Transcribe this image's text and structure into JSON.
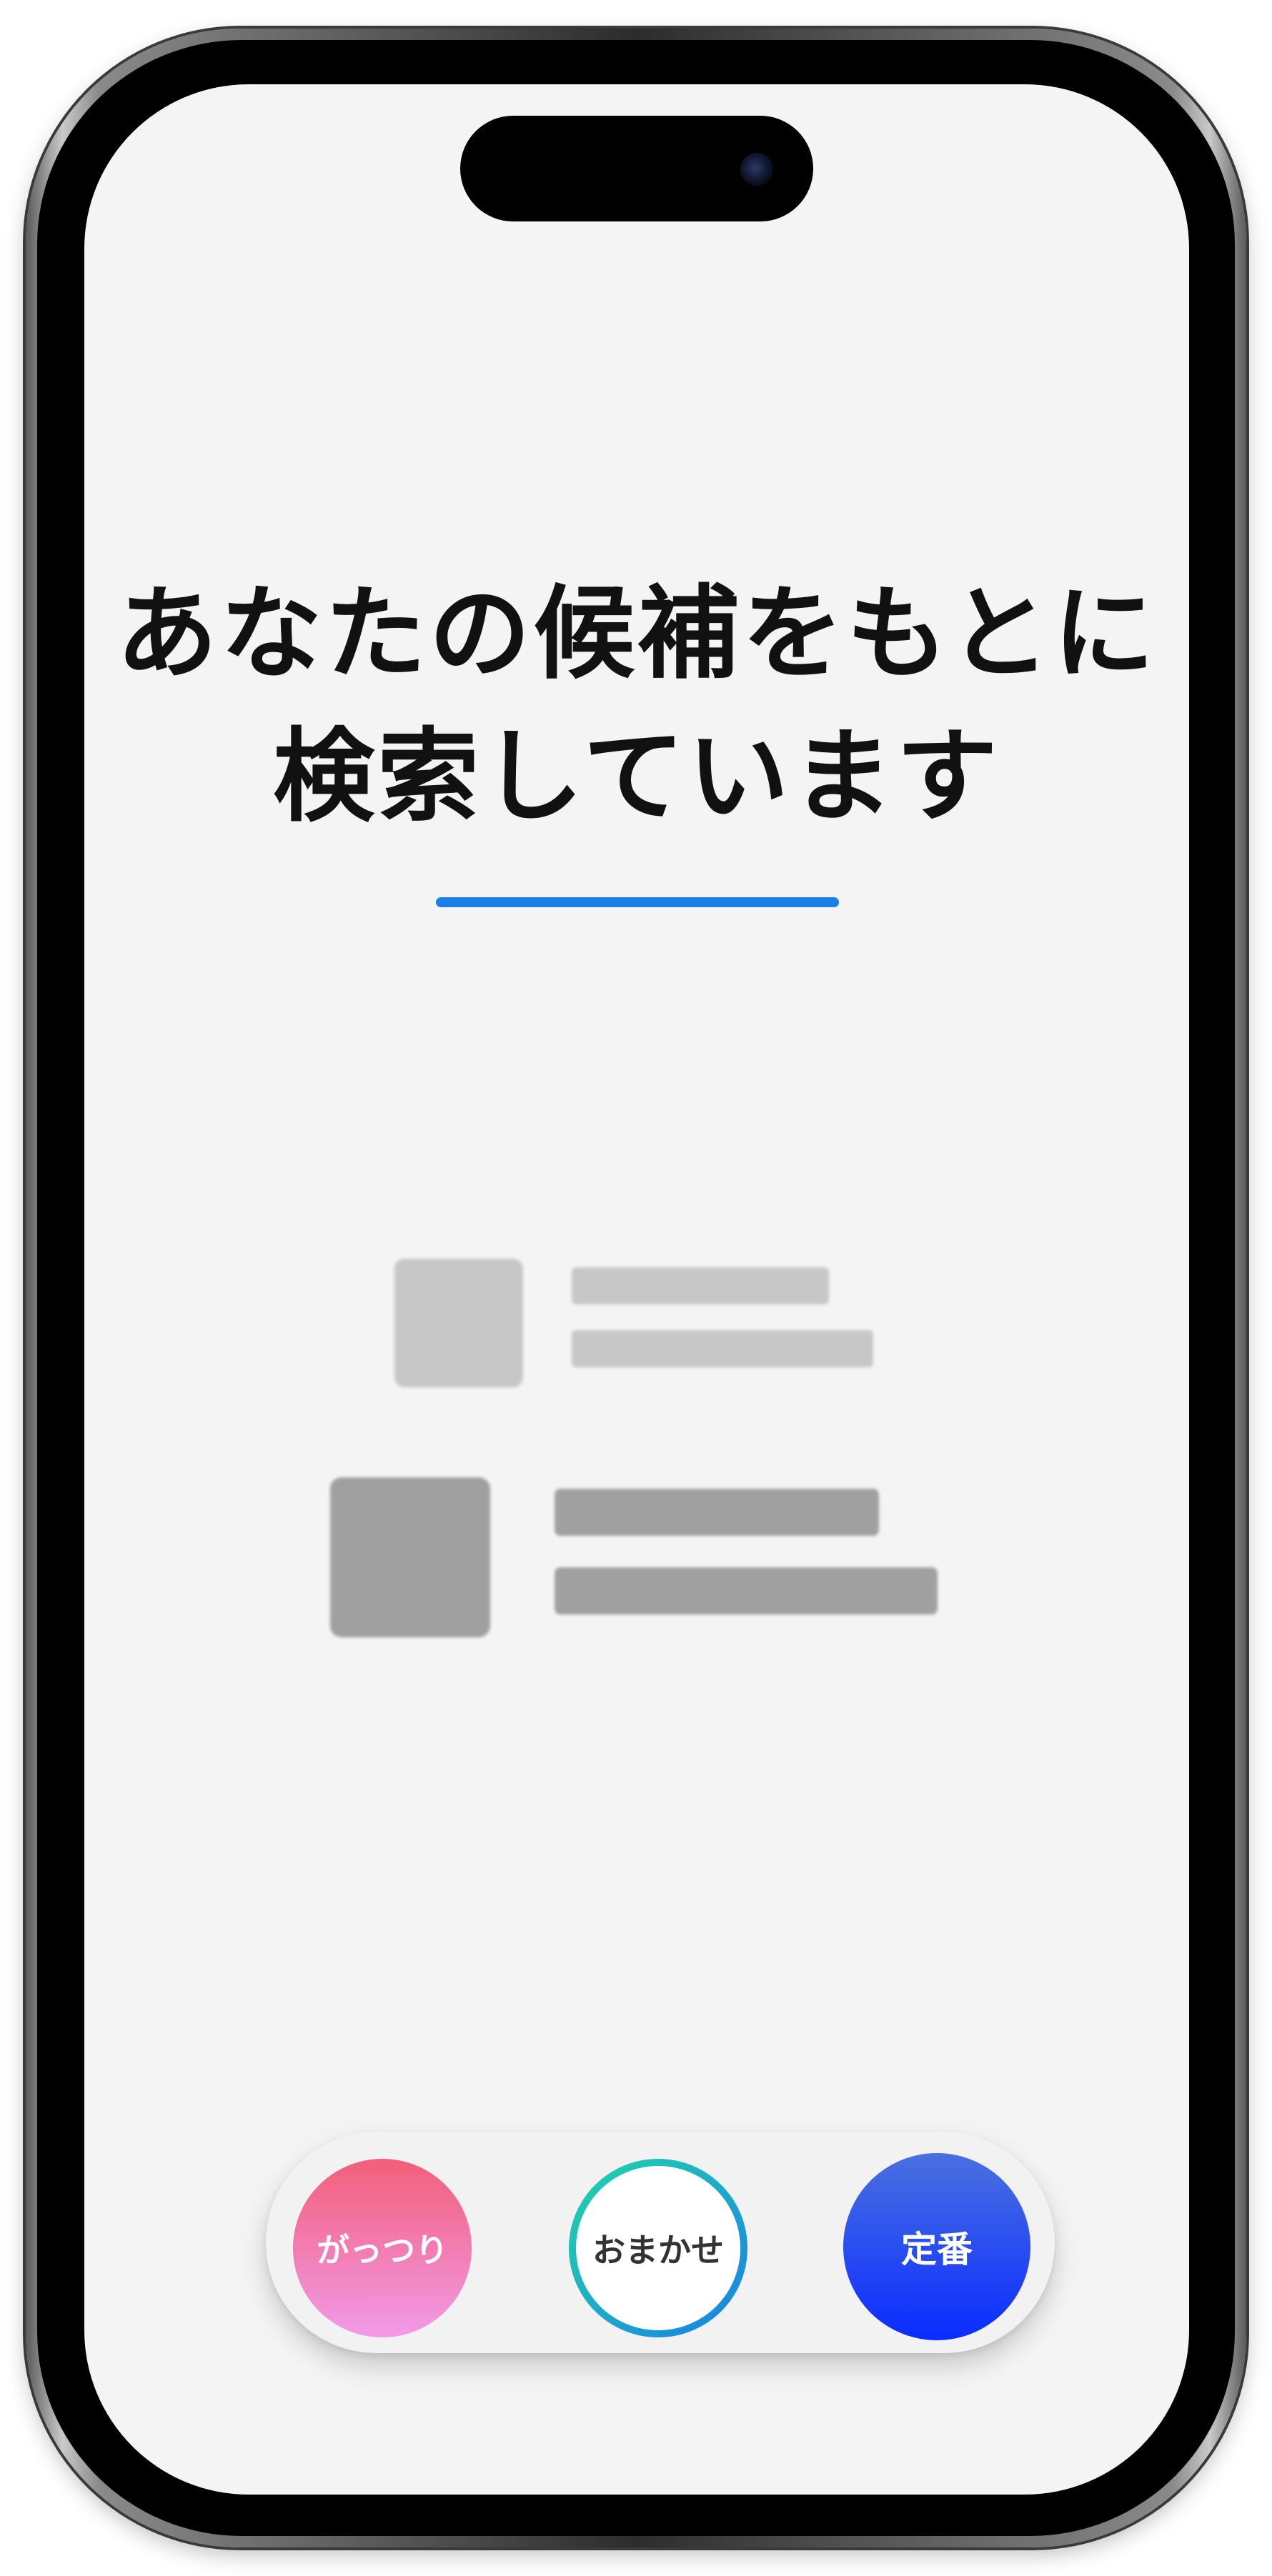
{
  "headline": {
    "line1": "あなたの候補をもとに",
    "line2": "検索しています"
  },
  "colors": {
    "accent_bar": "#1a7fe6",
    "gattsuri_top": "#f25f7a",
    "gattsuri_bottom": "#f29ae8",
    "omakase_ring_start": "#20d6a8",
    "omakase_ring_end": "#1a7fe6",
    "teiban_top": "#4a70e0",
    "teiban_bottom": "#0a2cff"
  },
  "choices": [
    {
      "label": "がっつり",
      "selected": false
    },
    {
      "label": "おまかせ",
      "selected": true
    },
    {
      "label": "定番",
      "selected": false
    }
  ]
}
